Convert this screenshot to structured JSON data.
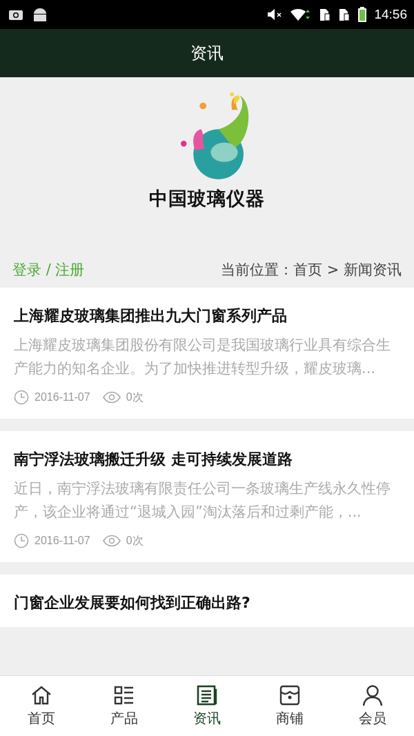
{
  "status_bar": {
    "time": "14:56"
  },
  "header": {
    "title": "资讯"
  },
  "banner": {
    "logo_text": "中国玻璃仪器"
  },
  "login_bar": {
    "login": "登录 / 注册",
    "breadcrumb": "当前位置：首页 > 新闻资讯"
  },
  "articles": [
    {
      "title": "上海耀皮玻璃集团推出九大门窗系列产品",
      "summary": "上海耀皮玻璃集团股份有限公司是我国玻璃行业具有综合生产能力的知名企业。为了加快推进转型升级，耀皮玻璃...",
      "date": "2016-11-07",
      "views": "0次"
    },
    {
      "title": "南宁浮法玻璃搬迁升级 走可持续发展道路",
      "summary": "近日，南宁浮法玻璃有限责任公司一条玻璃生产线永久性停产，该企业将通过“退城入园”淘汰落后和过剩产能，...",
      "date": "2016-11-07",
      "views": "0次"
    },
    {
      "title": "门窗企业发展要如何找到正确出路?"
    }
  ],
  "tabs": [
    {
      "kind": "home",
      "label": "首页",
      "selected": false
    },
    {
      "kind": "list",
      "label": "产品",
      "selected": false
    },
    {
      "kind": "news",
      "label": "资讯",
      "selected": true
    },
    {
      "kind": "shop",
      "label": "商铺",
      "selected": false
    },
    {
      "kind": "user",
      "label": "会员",
      "selected": false
    }
  ]
}
